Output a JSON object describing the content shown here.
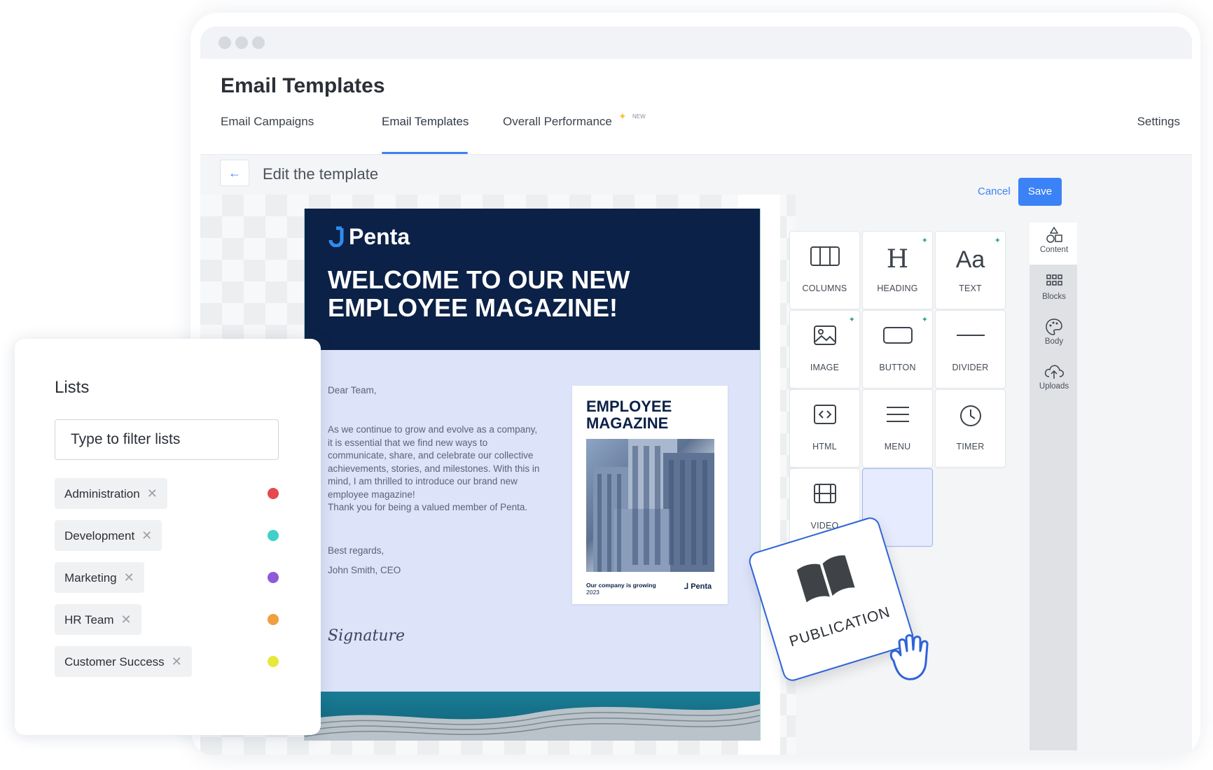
{
  "app": {
    "title": "Email Templates",
    "tabs": [
      {
        "label": "Email Campaigns"
      },
      {
        "label": "Email Templates",
        "active": true
      },
      {
        "label": "Overall Performance",
        "badge": "NEW"
      }
    ],
    "settings_label": "Settings"
  },
  "editor": {
    "title": "Edit the template",
    "cancel_label": "Cancel",
    "save_label": "Save"
  },
  "email": {
    "logo": "Penta",
    "headline": "WELCOME TO OUR NEW EMPLOYEE MAGAZINE!",
    "greeting": "Dear Team,",
    "body": "As we continue to grow and evolve as a company, it is essential that we find new ways to communicate, share, and celebrate our collective achievements, stories, and milestones. With this in mind, I am thrilled to introduce our brand new employee magazine!",
    "thanks": "Thank you for being a valued member of Penta.",
    "closing": "Best regards,",
    "sender": "John Smith, CEO",
    "signature": "Signature",
    "magazine": {
      "title_line1": "EMPLOYEE",
      "title_line2": "MAGAZINE",
      "footer_line1": "Our company is growing",
      "footer_line2": "2023",
      "logo": "Penta"
    }
  },
  "content_tools": [
    {
      "label": "COLUMNS",
      "icon": "columns-icon"
    },
    {
      "label": "HEADING",
      "icon": "heading-icon",
      "glyph": "H",
      "ai": true
    },
    {
      "label": "TEXT",
      "icon": "text-icon",
      "glyph": "Aa",
      "ai": true
    },
    {
      "label": "IMAGE",
      "icon": "image-icon",
      "ai": true
    },
    {
      "label": "BUTTON",
      "icon": "button-icon",
      "ai": true
    },
    {
      "label": "DIVIDER",
      "icon": "divider-icon"
    },
    {
      "label": "HTML",
      "icon": "html-icon"
    },
    {
      "label": "MENU",
      "icon": "menu-icon"
    },
    {
      "label": "TIMER",
      "icon": "timer-icon"
    },
    {
      "label": "VIDEO",
      "icon": "video-icon"
    }
  ],
  "sidebar": [
    {
      "label": "Content",
      "icon": "shapes-icon"
    },
    {
      "label": "Blocks",
      "icon": "blocks-icon"
    },
    {
      "label": "Body",
      "icon": "palette-icon"
    },
    {
      "label": "Uploads",
      "icon": "cloud-upload-icon"
    }
  ],
  "drag_card": {
    "label": "PUBLICATION",
    "icon": "book-icon"
  },
  "lists_panel": {
    "title": "Lists",
    "filter_placeholder": "Type to filter lists",
    "items": [
      {
        "label": "Administration",
        "color": "#e5484d"
      },
      {
        "label": "Development",
        "color": "#3fd0c9"
      },
      {
        "label": "Marketing",
        "color": "#8b5cd6"
      },
      {
        "label": "HR Team",
        "color": "#f0a040"
      },
      {
        "label": "Customer Success",
        "color": "#e8e83a"
      }
    ]
  }
}
